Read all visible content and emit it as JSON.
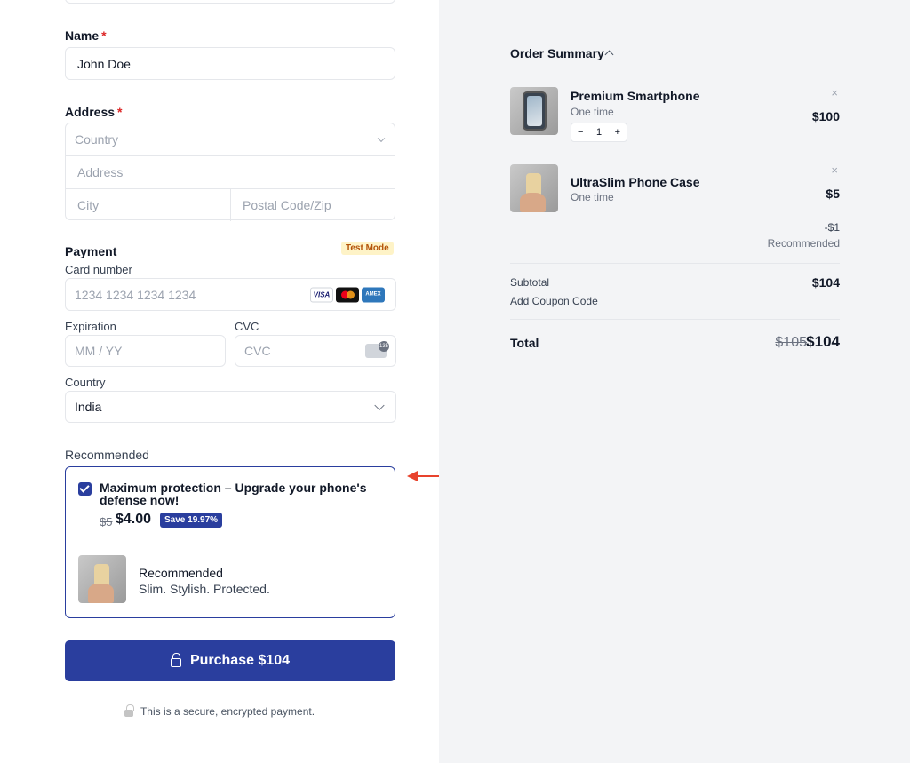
{
  "form": {
    "name": {
      "label": "Name",
      "required_mark": "*",
      "value": "John Doe"
    },
    "address": {
      "label": "Address",
      "required_mark": "*",
      "country_placeholder": "Country",
      "address_placeholder": "Address",
      "city_placeholder": "City",
      "postal_placeholder": "Postal Code/Zip"
    },
    "payment": {
      "label": "Payment",
      "test_mode_badge": "Test Mode",
      "card_number_label": "Card number",
      "card_number_placeholder": "1234 1234 1234 1234",
      "card_brands": [
        "VISA",
        "mastercard",
        "AMEX"
      ],
      "expiration_label": "Expiration",
      "expiration_placeholder": "MM / YY",
      "cvc_label": "CVC",
      "cvc_placeholder": "CVC",
      "cvc_icon_text": "135",
      "country_label": "Country",
      "country_value": "India"
    },
    "recommended": {
      "section_label": "Recommended",
      "checked": true,
      "title": "Maximum protection – Upgrade your phone's defense now!",
      "old_price": "$5",
      "new_price": "$4.00",
      "save_badge": "Save 19.97%",
      "product_name": "Recommended",
      "product_desc": "Slim. Stylish. Protected."
    },
    "purchase_label": "Purchase $104",
    "secure_note": "This is a secure, encrypted payment."
  },
  "summary": {
    "title": "Order Summary",
    "items": [
      {
        "name": "Premium Smartphone",
        "frequency": "One time",
        "price": "$100",
        "quantity": "1",
        "minus": "−",
        "plus": "+"
      },
      {
        "name": "UltraSlim Phone Case",
        "frequency": "One time",
        "price": "$5",
        "discount": "-$1",
        "discount_label": "Recommended"
      }
    ],
    "close_symbol": "×",
    "subtotal_label": "Subtotal",
    "subtotal_value": "$104",
    "coupon_label": "Add Coupon Code",
    "total_label": "Total",
    "total_old": "$105",
    "total_new": "$104"
  },
  "colors": {
    "accent": "#2a3e9e",
    "required": "#dc2626",
    "annotation_arrow": "#e8432d",
    "right_panel_bg": "#f3f4f6"
  }
}
